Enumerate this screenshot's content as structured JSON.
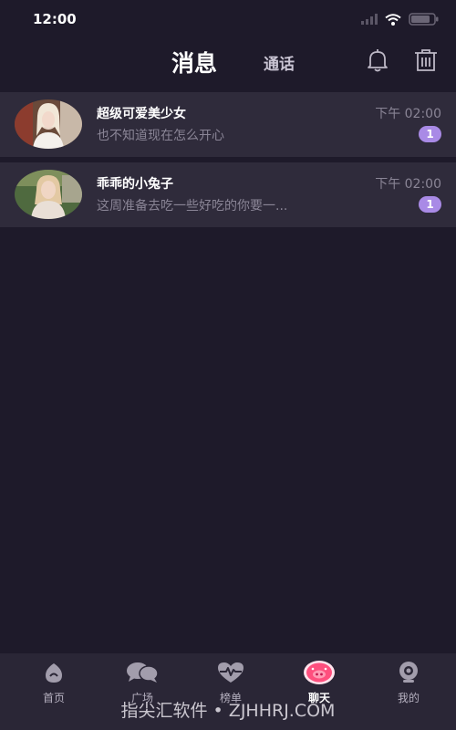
{
  "status_bar": {
    "time": "12:00"
  },
  "header": {
    "tabs": [
      {
        "label": "消息",
        "active": true
      },
      {
        "label": "通话",
        "active": false
      }
    ]
  },
  "conversations": [
    {
      "name": "超级可爱美少女",
      "preview": "也不知道现在怎么开心",
      "time": "下午  02:00",
      "unread": "1"
    },
    {
      "name": "乖乖的小兔子",
      "preview": "这周准备去吃一些好吃的你要一...",
      "time": "下午  02:00",
      "unread": "1"
    }
  ],
  "tabbar": {
    "items": [
      {
        "label": "首页",
        "icon": "home-drop-icon",
        "active": false
      },
      {
        "label": "广场",
        "icon": "chat-bubbles-icon",
        "active": false
      },
      {
        "label": "榜单",
        "icon": "heartbeat-icon",
        "active": false
      },
      {
        "label": "聊天",
        "icon": "pig-chat-icon",
        "active": true
      },
      {
        "label": "我的",
        "icon": "profile-camera-icon",
        "active": false
      }
    ]
  },
  "watermark": "指尖汇软件 • ZJHHRJ.COM",
  "colors": {
    "background": "#1e1a2a",
    "row": "#2f2b3b",
    "badge": "#a98ae6",
    "active_tab": "#ff4f7e"
  }
}
